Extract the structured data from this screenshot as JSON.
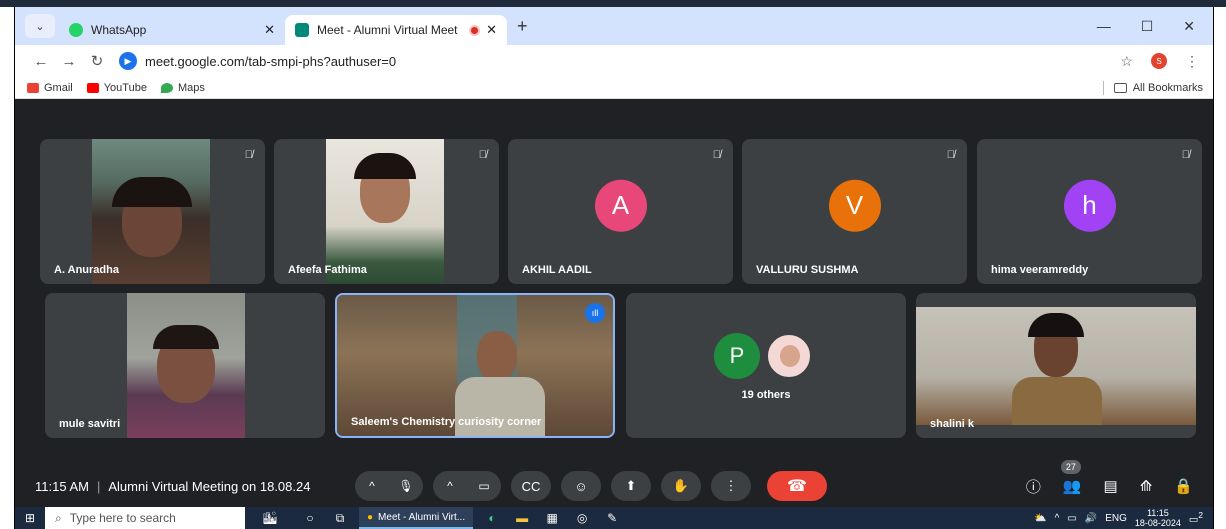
{
  "browser": {
    "tabs": [
      {
        "title": "WhatsApp",
        "icon": "whatsapp-icon",
        "active": false
      },
      {
        "title": "Meet - Alumni Virtual Meet",
        "icon": "meet-icon",
        "active": true
      }
    ],
    "url": "meet.google.com/tab-smpi-phs?authuser=0",
    "profile_initial": "S",
    "bookmarks": [
      {
        "label": "Gmail",
        "color": "#ea4335"
      },
      {
        "label": "YouTube",
        "color": "#ff0000"
      },
      {
        "label": "Maps",
        "color": "#34a853"
      }
    ],
    "all_bookmarks": "All Bookmarks"
  },
  "participants_row1": [
    {
      "name": "A. Anuradha",
      "type": "video"
    },
    {
      "name": "Afeefa Fathima",
      "type": "video"
    },
    {
      "name": "AKHIL AADIL",
      "type": "avatar",
      "initial": "A",
      "color": "#e8477a"
    },
    {
      "name": "VALLURU SUSHMA",
      "type": "avatar",
      "initial": "V",
      "color": "#e8710a"
    },
    {
      "name": "hima veeramreddy",
      "type": "avatar",
      "initial": "h",
      "color": "#a142f4"
    }
  ],
  "participants_row2": [
    {
      "name": "mule savitri",
      "type": "video"
    },
    {
      "name": "Saleem's Chemistry curiosity corner",
      "type": "video",
      "speaking": true
    },
    {
      "name": "19 others",
      "type": "others",
      "initial": "P",
      "color": "#1e8e3e"
    },
    {
      "name": "shalini k",
      "type": "video"
    }
  ],
  "meeting": {
    "time": "11:15 AM",
    "title": "Alumni Virtual Meeting on 18.08.24",
    "people_count": "27"
  },
  "taskbar": {
    "search_placeholder": "Type here to search",
    "app_label": "Meet - Alumni Virt...",
    "lang": "ENG",
    "time": "11:15",
    "date": "18-08-2024",
    "notif": "2"
  }
}
